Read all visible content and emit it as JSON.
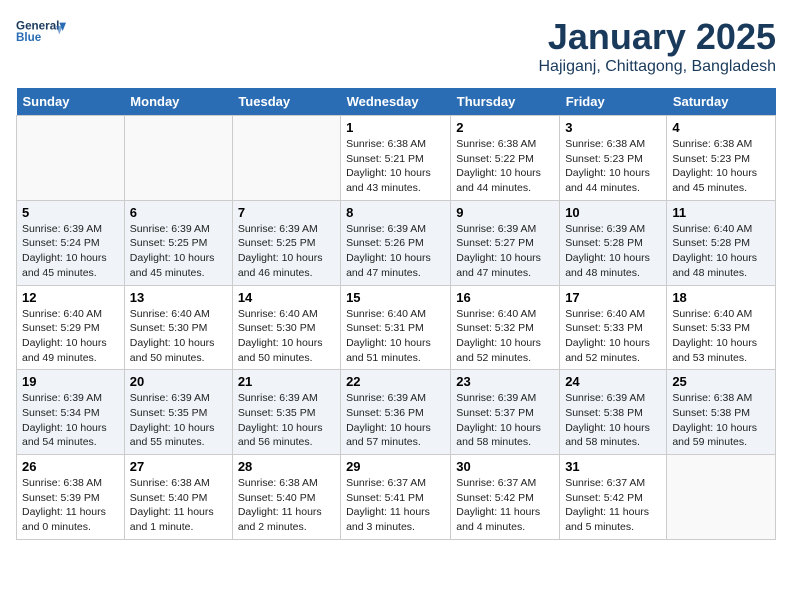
{
  "logo": {
    "line1": "General",
    "line2": "Blue"
  },
  "title": "January 2025",
  "location": "Hajiganj, Chittagong, Bangladesh",
  "weekdays": [
    "Sunday",
    "Monday",
    "Tuesday",
    "Wednesday",
    "Thursday",
    "Friday",
    "Saturday"
  ],
  "weeks": [
    [
      {
        "day": "",
        "info": ""
      },
      {
        "day": "",
        "info": ""
      },
      {
        "day": "",
        "info": ""
      },
      {
        "day": "1",
        "info": "Sunrise: 6:38 AM\nSunset: 5:21 PM\nDaylight: 10 hours\nand 43 minutes."
      },
      {
        "day": "2",
        "info": "Sunrise: 6:38 AM\nSunset: 5:22 PM\nDaylight: 10 hours\nand 44 minutes."
      },
      {
        "day": "3",
        "info": "Sunrise: 6:38 AM\nSunset: 5:23 PM\nDaylight: 10 hours\nand 44 minutes."
      },
      {
        "day": "4",
        "info": "Sunrise: 6:38 AM\nSunset: 5:23 PM\nDaylight: 10 hours\nand 45 minutes."
      }
    ],
    [
      {
        "day": "5",
        "info": "Sunrise: 6:39 AM\nSunset: 5:24 PM\nDaylight: 10 hours\nand 45 minutes."
      },
      {
        "day": "6",
        "info": "Sunrise: 6:39 AM\nSunset: 5:25 PM\nDaylight: 10 hours\nand 45 minutes."
      },
      {
        "day": "7",
        "info": "Sunrise: 6:39 AM\nSunset: 5:25 PM\nDaylight: 10 hours\nand 46 minutes."
      },
      {
        "day": "8",
        "info": "Sunrise: 6:39 AM\nSunset: 5:26 PM\nDaylight: 10 hours\nand 47 minutes."
      },
      {
        "day": "9",
        "info": "Sunrise: 6:39 AM\nSunset: 5:27 PM\nDaylight: 10 hours\nand 47 minutes."
      },
      {
        "day": "10",
        "info": "Sunrise: 6:39 AM\nSunset: 5:28 PM\nDaylight: 10 hours\nand 48 minutes."
      },
      {
        "day": "11",
        "info": "Sunrise: 6:40 AM\nSunset: 5:28 PM\nDaylight: 10 hours\nand 48 minutes."
      }
    ],
    [
      {
        "day": "12",
        "info": "Sunrise: 6:40 AM\nSunset: 5:29 PM\nDaylight: 10 hours\nand 49 minutes."
      },
      {
        "day": "13",
        "info": "Sunrise: 6:40 AM\nSunset: 5:30 PM\nDaylight: 10 hours\nand 50 minutes."
      },
      {
        "day": "14",
        "info": "Sunrise: 6:40 AM\nSunset: 5:30 PM\nDaylight: 10 hours\nand 50 minutes."
      },
      {
        "day": "15",
        "info": "Sunrise: 6:40 AM\nSunset: 5:31 PM\nDaylight: 10 hours\nand 51 minutes."
      },
      {
        "day": "16",
        "info": "Sunrise: 6:40 AM\nSunset: 5:32 PM\nDaylight: 10 hours\nand 52 minutes."
      },
      {
        "day": "17",
        "info": "Sunrise: 6:40 AM\nSunset: 5:33 PM\nDaylight: 10 hours\nand 52 minutes."
      },
      {
        "day": "18",
        "info": "Sunrise: 6:40 AM\nSunset: 5:33 PM\nDaylight: 10 hours\nand 53 minutes."
      }
    ],
    [
      {
        "day": "19",
        "info": "Sunrise: 6:39 AM\nSunset: 5:34 PM\nDaylight: 10 hours\nand 54 minutes."
      },
      {
        "day": "20",
        "info": "Sunrise: 6:39 AM\nSunset: 5:35 PM\nDaylight: 10 hours\nand 55 minutes."
      },
      {
        "day": "21",
        "info": "Sunrise: 6:39 AM\nSunset: 5:35 PM\nDaylight: 10 hours\nand 56 minutes."
      },
      {
        "day": "22",
        "info": "Sunrise: 6:39 AM\nSunset: 5:36 PM\nDaylight: 10 hours\nand 57 minutes."
      },
      {
        "day": "23",
        "info": "Sunrise: 6:39 AM\nSunset: 5:37 PM\nDaylight: 10 hours\nand 58 minutes."
      },
      {
        "day": "24",
        "info": "Sunrise: 6:39 AM\nSunset: 5:38 PM\nDaylight: 10 hours\nand 58 minutes."
      },
      {
        "day": "25",
        "info": "Sunrise: 6:38 AM\nSunset: 5:38 PM\nDaylight: 10 hours\nand 59 minutes."
      }
    ],
    [
      {
        "day": "26",
        "info": "Sunrise: 6:38 AM\nSunset: 5:39 PM\nDaylight: 11 hours\nand 0 minutes."
      },
      {
        "day": "27",
        "info": "Sunrise: 6:38 AM\nSunset: 5:40 PM\nDaylight: 11 hours\nand 1 minute."
      },
      {
        "day": "28",
        "info": "Sunrise: 6:38 AM\nSunset: 5:40 PM\nDaylight: 11 hours\nand 2 minutes."
      },
      {
        "day": "29",
        "info": "Sunrise: 6:37 AM\nSunset: 5:41 PM\nDaylight: 11 hours\nand 3 minutes."
      },
      {
        "day": "30",
        "info": "Sunrise: 6:37 AM\nSunset: 5:42 PM\nDaylight: 11 hours\nand 4 minutes."
      },
      {
        "day": "31",
        "info": "Sunrise: 6:37 AM\nSunset: 5:42 PM\nDaylight: 11 hours\nand 5 minutes."
      },
      {
        "day": "",
        "info": ""
      }
    ]
  ]
}
